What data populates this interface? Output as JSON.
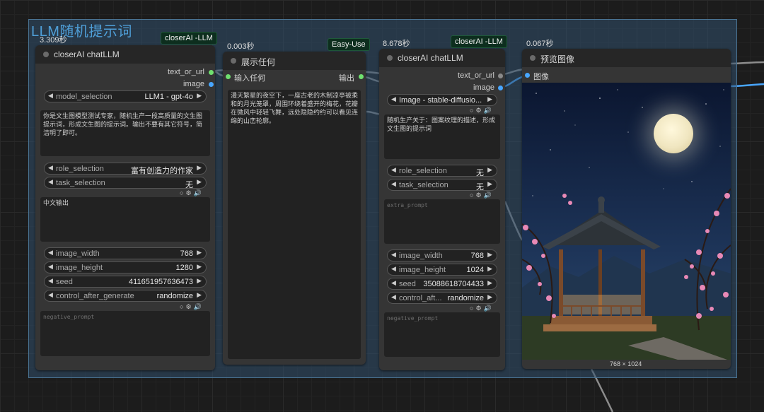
{
  "group": {
    "title": "LLM随机提示词"
  },
  "node1": {
    "timer": "3.309秒",
    "badge": "closerAI -LLM",
    "title": "closerAI chatLLM",
    "outputs": [
      "text_or_url",
      "image"
    ],
    "model_selection": {
      "name": "model_selection",
      "value": "LLM1 - gpt-4o"
    },
    "prompt_text": "你是文生图模型测试专家，随机生产一段高质量的文生图提示词，形成文生图的提示词。输出不要有其它符号，简洁明了即可。",
    "role_selection": {
      "name": "role_selection",
      "value": "富有创造力的作家"
    },
    "task_selection": {
      "name": "task_selection",
      "value": "无"
    },
    "extra_text": "中文输出",
    "image_width": {
      "name": "image_width",
      "value": "768"
    },
    "image_height": {
      "name": "image_height",
      "value": "1280"
    },
    "seed": {
      "name": "seed",
      "value": "411651957636473"
    },
    "control_after_generate": {
      "name": "control_after_generate",
      "value": "randomize"
    },
    "negative_placeholder": "negative_prompt"
  },
  "node2": {
    "timer": "0.003秒",
    "badge": "Easy-Use",
    "title": "展示任何",
    "input": "输入任何",
    "output": "输出",
    "text": "漫天繁星的夜空下，一座古老的木制凉亭被柔和的月光笼罩，周围环绕着盛开的梅花，花瓣在微风中轻轻飞舞，远处隐隐约约可以看见连绵的山峦轮廓。"
  },
  "node3": {
    "timer": "8.678秒",
    "badge": "closerAI -LLM",
    "title": "closerAI chatLLM",
    "outputs": [
      "text_or_url",
      "image"
    ],
    "model_selection": {
      "value": "Image - stable-diffusio..."
    },
    "prompt_text": "随机生产关于：图案纹理的描述，形成文生图的提示词",
    "role_selection": {
      "name": "role_selection",
      "value": "无"
    },
    "task_selection": {
      "name": "task_selection",
      "value": "无"
    },
    "extra_placeholder": "extra_prompt",
    "image_width": {
      "name": "image_width",
      "value": "768"
    },
    "image_height": {
      "name": "image_height",
      "value": "1024"
    },
    "seed": {
      "name": "seed",
      "value": "35088618704433"
    },
    "control_after_generate": {
      "name": "control_aft...",
      "value": "randomize"
    },
    "negative_placeholder": "negative_prompt"
  },
  "node4": {
    "timer": "0.067秒",
    "title": "预览图像",
    "input": "图像",
    "image_size": "768 × 1024"
  },
  "icons": {
    "radio": "○",
    "gear": "⚙",
    "speaker": "🔊",
    "left": "◀",
    "right": "▶"
  },
  "colors": {
    "group": "#4f9fd8",
    "string_slot": "#6fe06f",
    "image_slot": "#48a6ff"
  }
}
